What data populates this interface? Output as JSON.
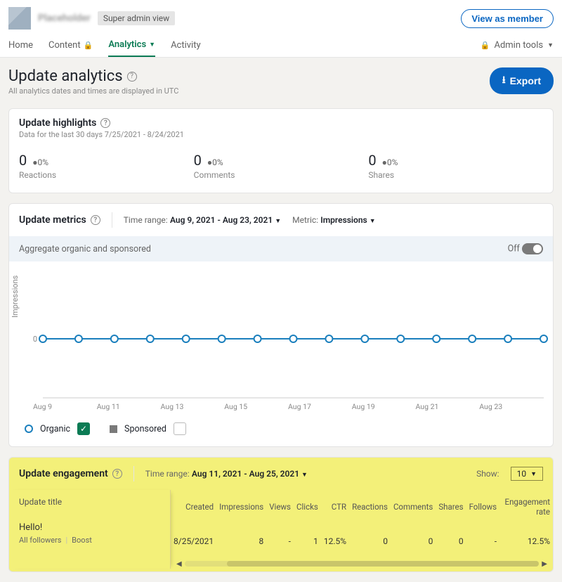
{
  "header": {
    "company": "Placeholder",
    "badge": "Super admin view",
    "view_member": "View as member",
    "tabs": [
      "Home",
      "Content",
      "Analytics",
      "Activity"
    ],
    "admin_tools": "Admin tools"
  },
  "page": {
    "title": "Update analytics",
    "subtitle": "All analytics dates and times are displayed in UTC",
    "export": "Export"
  },
  "highlights": {
    "title": "Update highlights",
    "sub": "Data for the last 30 days 7/25/2021 - 8/24/2021",
    "cells": [
      {
        "value": "0",
        "delta": "0%",
        "label": "Reactions"
      },
      {
        "value": "0",
        "delta": "0%",
        "label": "Comments"
      },
      {
        "value": "0",
        "delta": "0%",
        "label": "Shares"
      }
    ]
  },
  "metrics": {
    "title": "Update metrics",
    "time_range_label": "Time range:",
    "time_range_value": "Aug 9, 2021 - Aug 23, 2021",
    "metric_label": "Metric:",
    "metric_value": "Impressions",
    "aggregate_label": "Aggregate organic and sponsored",
    "aggregate_state": "Off",
    "ylabel": "Impressions",
    "legend_organic": "Organic",
    "legend_sponsored": "Sponsored"
  },
  "chart_data": {
    "type": "line",
    "title": "",
    "xlabel": "",
    "ylabel": "Impressions",
    "ylim": [
      0,
      1
    ],
    "x_ticks": [
      "Aug 9",
      "Aug 11",
      "Aug 13",
      "Aug 15",
      "Aug 17",
      "Aug 19",
      "Aug 21",
      "Aug 23"
    ],
    "categories": [
      "Aug 9",
      "Aug 10",
      "Aug 11",
      "Aug 12",
      "Aug 13",
      "Aug 14",
      "Aug 15",
      "Aug 16",
      "Aug 17",
      "Aug 18",
      "Aug 19",
      "Aug 20",
      "Aug 21",
      "Aug 22",
      "Aug 23"
    ],
    "series": [
      {
        "name": "Organic",
        "color": "#1a7fbd",
        "values": [
          0,
          0,
          0,
          0,
          0,
          0,
          0,
          0,
          0,
          0,
          0,
          0,
          0,
          0,
          0
        ]
      }
    ]
  },
  "engagement": {
    "title": "Update engagement",
    "time_range_label": "Time range:",
    "time_range_value": "Aug 11, 2021 - Aug 25, 2021",
    "show_label": "Show:",
    "show_value": "10",
    "col_title": "Update title",
    "columns": [
      "Created",
      "Impressions",
      "Views",
      "Clicks",
      "CTR",
      "Reactions",
      "Comments",
      "Shares",
      "Follows",
      "Engagement rate"
    ],
    "rows": [
      {
        "title": "Hello!",
        "sub": "All followers",
        "boost": "Boost",
        "cells": [
          "8/25/2021",
          "8",
          "-",
          "1",
          "12.5%",
          "0",
          "0",
          "0",
          "-",
          "12.5%"
        ]
      }
    ]
  }
}
